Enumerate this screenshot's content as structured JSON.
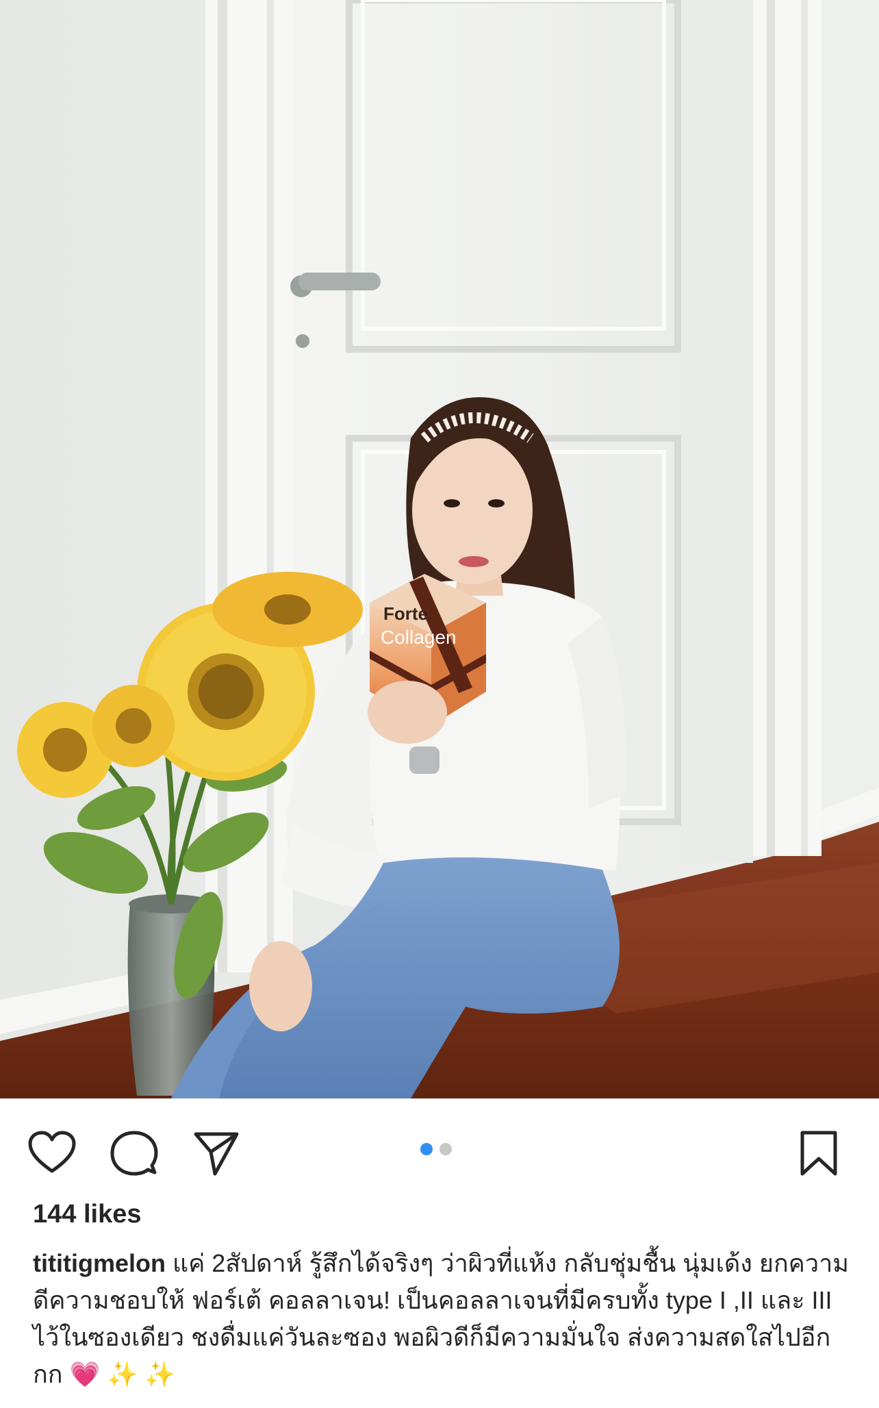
{
  "post": {
    "image_alt": "Woman sitting by a white door holding a Forte Collagen box beside a vase of sunflowers",
    "product_label_brand": "Forte",
    "product_label_name": "Collagen"
  },
  "actions": {
    "like_icon": "heart-outline-icon",
    "comment_icon": "comment-bubble-icon",
    "share_icon": "paper-plane-icon",
    "bookmark_icon": "bookmark-outline-icon"
  },
  "carousel": {
    "total": 2,
    "active_index": 0,
    "active_color": "#2f8ff7",
    "inactive_color": "#c7c7c7"
  },
  "likes": {
    "label": "144 likes"
  },
  "caption": {
    "username": "tititigmelon",
    "text": " แค่ 2สัปดาห์ รู้สึกได้จริงๆ ว่าผิวที่แห้ง กลับชุ่มชื้น นุ่มเด้ง ยกความดีความชอบให้ ฟอร์เต้ คอลลาเจน! เป็นคอลลาเจนที่มีครบทั้ง type I ,II และ III ไว้ในซองเดียว ชงดื่มแค่วันละซอง พอผิวดีก็มีความมั่นใจ ส่งความสดใสไปอีกกก ",
    "emoji_heart": "💗",
    "emoji_sparkle_1": "✨",
    "emoji_sparkle_2": "✨"
  }
}
